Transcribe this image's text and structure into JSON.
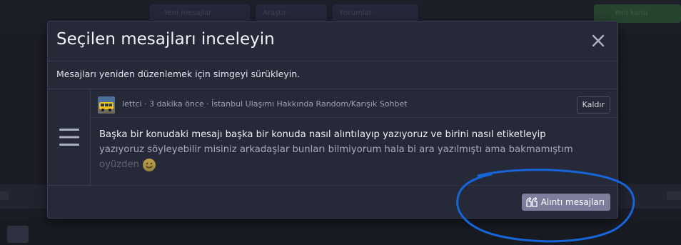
{
  "background": {
    "tabs": [
      "Yeni mesajlar",
      "Araştır",
      "Forumlar"
    ],
    "action_label": "Yeni konu"
  },
  "modal": {
    "title": "Seçilen mesajları inceleyin",
    "instructions": "Mesajları yeniden düzenlemek için simgeyi sürükleyin.",
    "quote_button_label": "Alıntı mesajları",
    "message": {
      "author": "lettci",
      "separator1": " · ",
      "time": "3 dakika önce",
      "separator2": " · ",
      "thread": "İstanbul Ulaşımı Hakkında Random/Karışık Sohbet",
      "remove_label": "Kaldır",
      "line1": "Başka bir konudaki mesajı başka bir konuda nasıl alıntılayıp yazıyoruz ve birini nasıl etiketleyip",
      "line2": "yazıyoruz söyleyebilir misiniz arkadaşlar bunları bilmiyorum hala bi ara yazılmıştı ama bakmamıştım",
      "line3": "oyüzden"
    }
  },
  "icons": {
    "close": "close-icon",
    "drag": "drag-handle-icon",
    "avatar": "avatar-bus-image",
    "emoji": "smile-emoji",
    "quote": "quote-icon"
  },
  "colors": {
    "modal_bg": "#262937",
    "page_bg": "#1b1d26",
    "button_accent": "#7c7e9c",
    "annotation": "#1565d8"
  }
}
